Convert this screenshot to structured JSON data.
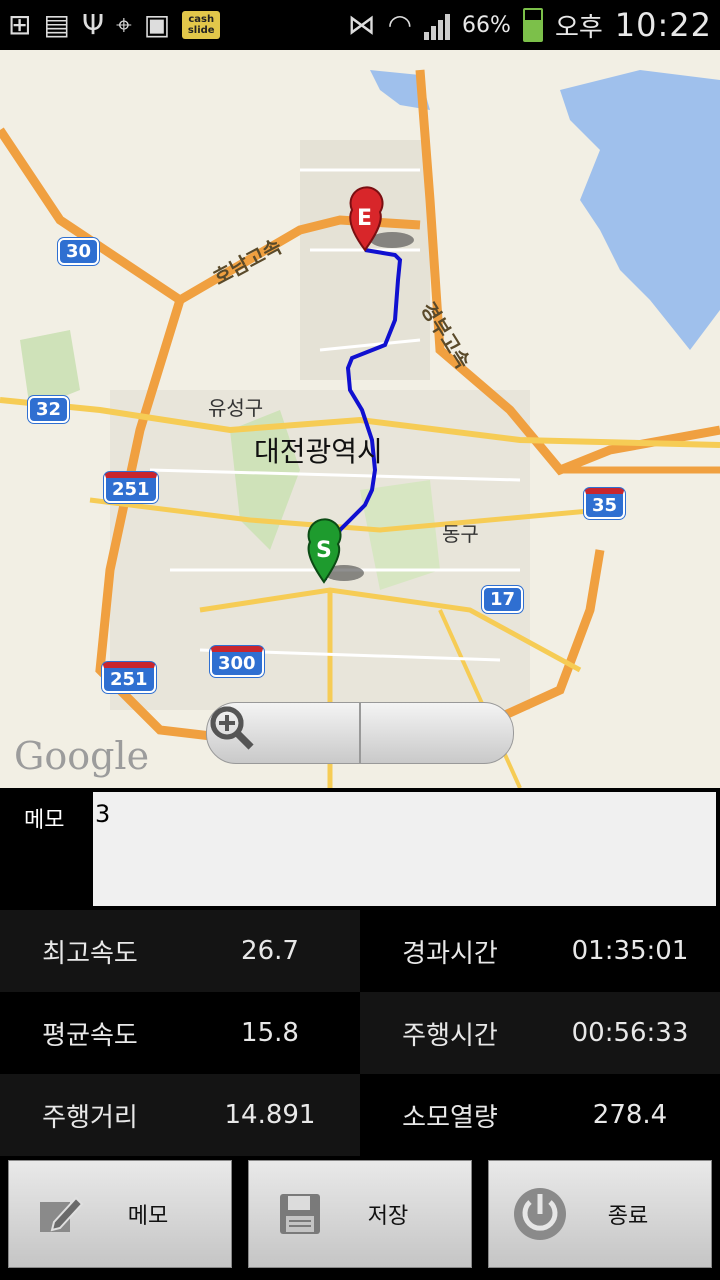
{
  "status_bar": {
    "icons": [
      "plus-icon",
      "storage-icon",
      "usb-icon",
      "gps-icon",
      "image-icon",
      "cashslide-icon",
      "mute-icon",
      "wifi-icon",
      "signal-icon",
      "battery-icon"
    ],
    "cashslide_text": "cash slide",
    "battery_percent": "66%",
    "battery_level": 0.66,
    "ampm": "오후",
    "time": "10:22"
  },
  "map": {
    "district_yuseong": "유성구",
    "district_dong": "동구",
    "city": "대전광역시",
    "highway_honam": "호남고속",
    "highway_gyeongbu": "경부고속",
    "shields": [
      "30",
      "32",
      "251",
      "251",
      "300",
      "35",
      "17"
    ],
    "marker_start": "S",
    "marker_end": "E",
    "route_color": "#1010d0",
    "logo": "Google",
    "zoom_out_icon": "zoom-out-icon",
    "zoom_in_icon": "zoom-in-icon"
  },
  "memo": {
    "label": "메모",
    "value": "3"
  },
  "stats": {
    "max_speed_label": "최고속도",
    "max_speed_value": "26.7",
    "elapsed_label": "경과시간",
    "elapsed_value": "01:35:01",
    "avg_speed_label": "평균속도",
    "avg_speed_value": "15.8",
    "drive_time_label": "주행시간",
    "drive_time_value": "00:56:33",
    "distance_label": "주행거리",
    "distance_value": "14.891",
    "calories_label": "소모열량",
    "calories_value": "278.4"
  },
  "buttons": {
    "memo": "메모",
    "save": "저장",
    "exit": "종료"
  }
}
